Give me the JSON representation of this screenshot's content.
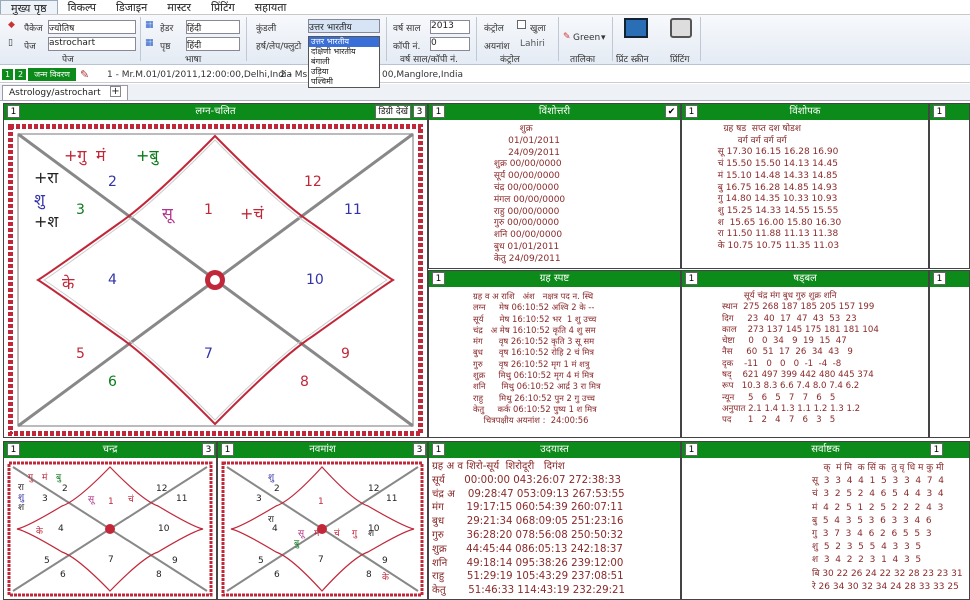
{
  "menu": [
    "मुख्य पृष्ठ",
    "विकल्प",
    "डिजाइन",
    "मास्टर",
    "प्रिंटिंग",
    "सहायता"
  ],
  "ribbon": {
    "package_label": "पैकेज",
    "package_value": "ज्योतिष",
    "page_label": "पेज",
    "page_value": "astrochart",
    "header_label": "हेडर",
    "header_value": "हिंदी",
    "body_label": "पृष्ठ",
    "body_value": "हिंदी",
    "kundli_label": "कुंडली",
    "kundli_value": "उत्तर भारतीय",
    "year_label": "वर्ष साल",
    "year_value": "2013",
    "copy_label": "कॉपी नं.",
    "copy_value": "0",
    "control_label": "कंट्रोल",
    "open_label": "खुला",
    "ayanamsha_label": "अयनांश",
    "ayanamsha_value": "Lahiri",
    "color_value": "Green",
    "print_screen_label": "प्रिंट स्क्रीन",
    "printing_label": "प्रिंटिंग",
    "grp_page": "पेज",
    "grp_lang": "भाषा",
    "grp_hrs": "हर्ष/लेप/फ्लुटो",
    "grp_year": "वर्ष साल/कॉपी नं.",
    "grp_control": "कंट्रोल",
    "grp_table": "तालिका",
    "dropdown_options": [
      "उत्तर भारतीय",
      "दक्षिणी भारतीय",
      "बंगाली",
      "उड़िया",
      "पश्चिमी"
    ]
  },
  "records": {
    "btn1": "1",
    "btn2": "2",
    "janm": "जन्म विवरण",
    "rec1": "1 - Mr.M.01/01/2011,12:00:00,Delhi,India",
    "rec2": "2 - Ms.F",
    "rec2b": "00,Manglore,India"
  },
  "doc_tab": "Astrology/astrochart",
  "panels": {
    "lagna": {
      "num": "1",
      "title": "लग्न-चलित",
      "degree_btn": "डिग्री देखें",
      "btn3": "3"
    },
    "vimshottari": {
      "num": "1",
      "title": "विंशोत्तरी"
    },
    "vimshopak": {
      "num": "1",
      "title": "विंशोपक",
      "num2": "1"
    },
    "grah": {
      "num": "1",
      "title": "ग्रह स्पष्ट"
    },
    "shadbal": {
      "num": "1",
      "title": "षड्बल",
      "num2": "1"
    },
    "chandra": {
      "num": "1",
      "title": "चन्द्र",
      "btn3": "3"
    },
    "navamsha": {
      "num": "1",
      "title": "नवमांश",
      "btn3": "3"
    },
    "udayast": {
      "num": "1",
      "title": "उदयास्त"
    },
    "sarvashtak": {
      "num": "1",
      "title": "सर्वाष्टक",
      "num2": "1"
    }
  },
  "lagna_chart": {
    "houses": [
      "1",
      "2",
      "3",
      "4",
      "5",
      "6",
      "7",
      "8",
      "9",
      "10",
      "11",
      "12"
    ],
    "planets": {
      "h1": "सू",
      "h1b": "+चं",
      "h2a": "+गु",
      "h2b": "मं",
      "h2c": "+बु",
      "h3a": "+रा",
      "h3b": "शु",
      "h3c": "+श",
      "h4": "के"
    }
  },
  "vimshottari_text": "          शुक्र\n      01/01/2011\n      24/09/2011\n शुक्र 00/00/0000\n सूर्य 00/00/0000\n चंद्र 00/00/0000\n मंगल 00/00/0000\n राहु 00/00/0000\n गुरु 00/00/0000\n शनि 00/00/0000\n बुध 01/01/2011\n केतु 24/09/2011",
  "vimshopak_text": "    ग्रह षड  सप्त दश षोडश\n         वर्ग वर्ग वर्ग वर्ग\n  सू 17.30 16.15 16.28 16.90\n  चं 15.50 15.50 14.13 14.45\n  मं 15.10 14.48 14.33 14.85\n  बु 16.75 16.28 14.85 14.93\n  गु 14.80 14.35 10.33 10.93\n  शु 15.25 14.33 14.55 15.55\n  श  15.65 16.00 15.80 16.30\n  रा 11.50 11.88 11.13 11.38\n  के 10.75 10.75 11.35 11.03",
  "grah_text": "ग्रह व अ राशि   अंश   नक्षत्र पद न. स्थि\nलग्न     मेष 06:10:52 अश्वि 2 के --\nसूर्य      मेष 16:10:52 भर  1 शु उच्च\nचंद्र   अ मेष 16:10:52 कृति 4 शु सम\nमंग      वृष 26:10:52 कृति 3 सू सम\nबुध      वृष 16:10:52 रोहि 2 चं मित्र\nगुरु      वृष 26:10:52 मृग 1 मं शत्रु\nशुक्र     मिथु 06:10:52 मृग 4 मं मित्र\nशनि      मिथु 06:10:52 आर्द्र 3 रा मित्र\nराहु      मिथु 26:10:52 पुन 2 गु उच्च\nकेतु     कर्क 06:10:52 पुष्य 1 श मित्र\n    चित्रपक्षीय अयनांश :  24:00:56",
  "shadbal_text": "        सूर्य चंद्र मंग बुध गुरु शुक्र शनि\nस्थान  275 268 187 185 205 157 199\nदिग     23  40  17  47  43  53  23\nकाल    273 137 145 175 181 181 104\nचेष्टा     0   0  34   9  19  15  47\nनैस     60  51  17  26  34  43   9\nदृक    -11   0   0   0  -1  -4  -8\nषद्    621 497 399 442 480 445 374\nरूप   10.3 8.3 6.6 7.4 8.0 7.4 6.2\nन्यून     5   6   5   7   7   6   5\nअनुपात 2.1 1.4 1.3 1.1 1.2 1.3 1.2\nपद      1   2   4   7   6   3   5",
  "udayast_text": "ग्रह अ व शिरो-सूर्य  शिरोदूरी   दिगंश\nसूर्य      00:00:00 043:26:07 272:38:33\nचंद्र अ    09:28:47 053:09:13 267:53:55\nमंग       19:17:15 060:54:39 260:07:11\nबुध       29:21:34 068:09:05 251:23:16\nगुरु       36:28:20 078:56:08 250:50:32\nशुक्र      44:45:44 086:05:13 242:18:37\nशनि      49:18:14 095:38:26 239:12:00\nराहु       51:29:19 105:43:29 237:08:51\nकेतु       51:46:33 114:43:19 232:29:21",
  "sarvashtak_text": "    क्  मं मि  क सिं क  तु वृ धि म कु मी\nसू  3  3  4  4  1  5  3  3  4  7  4\nचं  3  2  5  2  4  6  5  4  4  3  4\nमं  4  2  5  1  2  5  2  2  2  4  3\nबु  5  4  3  5  3  6  3  3  4  6\nगु  3  7  3  4  6  2  6  5  5  3\nशु  5  2  3  5  5  4  3  3  5\nश  3  4  2  2  3  1  4  3  5\nबि 30 22 26 24 22 32 28 23 23 31\nरे 26 34 30 32 34 24 28 33 33 25",
  "small_chart_chandra": {
    "houses": [
      "1",
      "2",
      "3",
      "4",
      "5",
      "6",
      "7",
      "8",
      "9",
      "10",
      "11",
      "12"
    ],
    "planets": [
      "सू",
      "मं",
      "बु",
      "चं",
      "के",
      "गु",
      "रा",
      "श",
      "शु"
    ]
  },
  "small_chart_navamsha": {
    "houses": [
      "1",
      "2",
      "3",
      "4",
      "5",
      "6",
      "7",
      "8",
      "9",
      "10",
      "11",
      "12"
    ],
    "planets": [
      "शु",
      "चं",
      "गु",
      "सू",
      "मं",
      "बु",
      "श",
      "रा",
      "के"
    ]
  },
  "colors": {
    "header_green": "#0c8a1a",
    "chart_border": "#c0283a",
    "chart_line": "#888"
  }
}
